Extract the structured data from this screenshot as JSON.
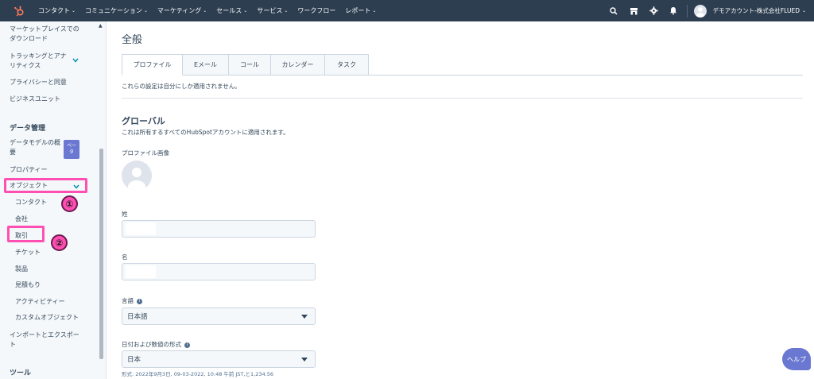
{
  "topnav": {
    "items": [
      {
        "label": "コンタクト",
        "caret": "⌄"
      },
      {
        "label": "コミュニケーション",
        "caret": "⌄"
      },
      {
        "label": "マーケティング",
        "caret": "⌄"
      },
      {
        "label": "セールス",
        "caret": "⌄"
      },
      {
        "label": "サービス",
        "caret": "⌄"
      },
      {
        "label": "ワークフロー",
        "caret": ""
      },
      {
        "label": "レポート",
        "caret": "⌄"
      }
    ],
    "icons": [
      "search-icon",
      "marketplace-icon",
      "settings-icon",
      "notifications-icon"
    ],
    "account_label": "デモアカウント-株式会社FLUED",
    "account_caret": "⌄",
    "nav_bg": "#2d3e50"
  },
  "sidebar": {
    "marketplace_line1": "マーケットプレイスでの",
    "marketplace_line2": "ダウンロード",
    "tracking_line1": "トラッキングとアナ",
    "tracking_line2": "リティクス",
    "privacy": "プライバシーと同意",
    "business_units": "ビジネスユニット",
    "data_heading": "データ管理",
    "data_model_line1": "データモデルの概",
    "data_model_line2": "要",
    "beta_line1": "ベー",
    "beta_line2": "タ",
    "properties": "プロパティー",
    "objects": "オブジェクト",
    "object_items": [
      "コンタクト",
      "会社",
      "取引",
      "チケット",
      "製品",
      "見積もり",
      "アクティビティー",
      "カスタムオブジェクト"
    ],
    "import_line1": "インポートとエクスポー",
    "import_line2": "ト",
    "tools_heading": "ツール",
    "badge1": "①",
    "badge2": "②",
    "highlight_color": "#ff4fb2"
  },
  "main": {
    "title": "全般",
    "tabs": [
      "プロファイル",
      "Eメール",
      "コール",
      "カレンダー",
      "タスク"
    ],
    "note": "これらの設定は自分にしか適用されません。",
    "section_title": "グローバル",
    "section_desc": "これは所有するすべてのHubSpotアカウントに適用されます。",
    "profile_image_label": "プロファイル画像",
    "last_name_label": "姓",
    "first_name_label": "名",
    "language_label": "言語",
    "language_value": "日本語",
    "format_label": "日付および数値の形式",
    "format_value": "日本",
    "format_note": "形式: 2022年9月3日, 09-03-2022, 10:48 午前 JST,と1,234.56",
    "info_glyph": "i"
  },
  "help": {
    "label": "ヘルプ"
  }
}
